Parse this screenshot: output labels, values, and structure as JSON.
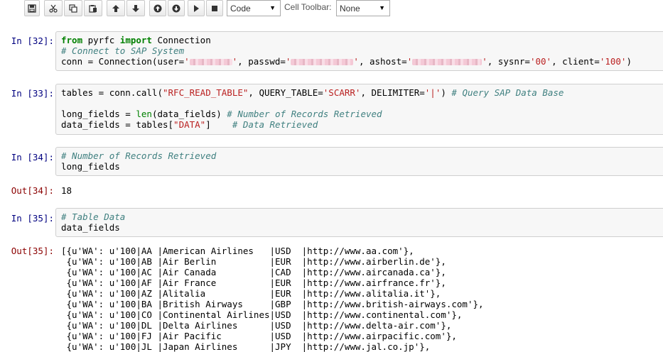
{
  "toolbar": {
    "buttons": [
      {
        "name": "save-icon"
      },
      {
        "name": "cut-icon"
      },
      {
        "name": "copy-icon"
      },
      {
        "name": "paste-icon"
      },
      {
        "name": "move-up-icon"
      },
      {
        "name": "move-down-icon"
      },
      {
        "name": "insert-above-icon"
      },
      {
        "name": "insert-below-icon"
      },
      {
        "name": "run-icon"
      },
      {
        "name": "stop-icon"
      }
    ],
    "cell_type": "Code",
    "cell_toolbar_label": "Cell Toolbar:",
    "cell_toolbar_value": "None"
  },
  "cells": {
    "c32": {
      "prompt": "In [32]:",
      "line1_kw1": "from",
      "line1_mod": " pyrfc ",
      "line1_kw2": "import",
      "line1_name": " Connection",
      "line2_comment": "# Connect to SAP System",
      "line3_a": "conn = Connection(user=",
      "line3_q1": "'",
      "line3_q2": "'",
      "line3_b": ", passwd=",
      "line3_c": ", ashost=",
      "line3_d": ", sysnr=",
      "line3_sysnr": "'00'",
      "line3_e": ", client=",
      "line3_client": "'100'",
      "line3_f": ")"
    },
    "c33": {
      "prompt": "In [33]:",
      "l1_a": "tables = conn.call(",
      "l1_s1": "\"RFC_READ_TABLE\"",
      "l1_b": ", QUERY_TABLE=",
      "l1_s2": "'SCARR'",
      "l1_c": ", DELIMITER=",
      "l1_s3": "'|'",
      "l1_d": ") ",
      "l1_comment": "# Query SAP Data Base",
      "l2_a": "long_fields = ",
      "l2_len": "len",
      "l2_b": "(data_fields) ",
      "l2_comment": "# Number of Records Retrieved",
      "l3_a": "data_fields = tables[",
      "l3_s": "\"DATA\"",
      "l3_b": "]    ",
      "l3_comment": "# Data Retrieved"
    },
    "c34": {
      "prompt": "In [34]:",
      "comment": "# Number of Records Retrieved",
      "code": "long_fields",
      "out_prompt": "Out[34]:",
      "output": "18"
    },
    "c35": {
      "prompt": "In [35]:",
      "comment": "# Table Data",
      "code": "data_fields",
      "out_prompt": "Out[35]:",
      "output_lines": [
        "[{u'WA': u'100|AA |American Airlines   |USD  |http://www.aa.com'},",
        " {u'WA': u'100|AB |Air Berlin          |EUR  |http://www.airberlin.de'},",
        " {u'WA': u'100|AC |Air Canada          |CAD  |http://www.aircanada.ca'},",
        " {u'WA': u'100|AF |Air France          |EUR  |http://www.airfrance.fr'},",
        " {u'WA': u'100|AZ |Alitalia            |EUR  |http://www.alitalia.it'},",
        " {u'WA': u'100|BA |British Airways     |GBP  |http://www.british-airways.com'},",
        " {u'WA': u'100|CO |Continental Airlines|USD  |http://www.continental.com'},",
        " {u'WA': u'100|DL |Delta Airlines      |USD  |http://www.delta-air.com'},",
        " {u'WA': u'100|FJ |Air Pacific         |USD  |http://www.airpacific.com'},",
        " {u'WA': u'100|JL |Japan Airlines      |JPY  |http://www.jal.co.jp'},"
      ]
    }
  }
}
